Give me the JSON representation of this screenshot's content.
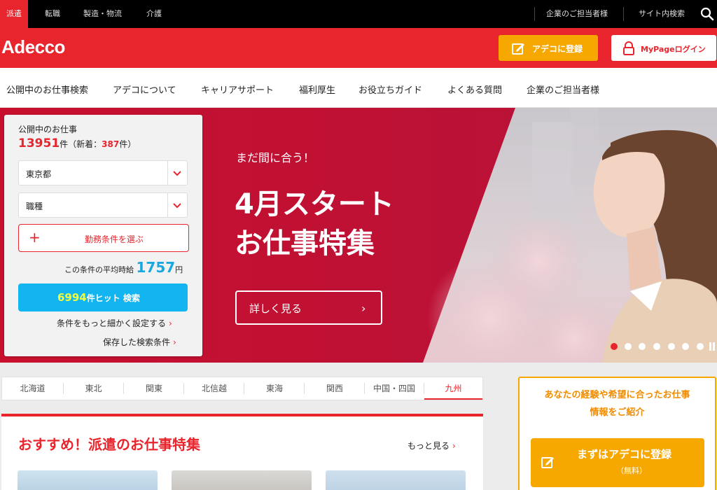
{
  "topbar": {
    "tabs": [
      "派遣",
      "転職",
      "製造・物流",
      "介護"
    ],
    "right_links": [
      "企業のご担当者様",
      "サイト内検索"
    ]
  },
  "header": {
    "logo": "Adecco",
    "register_label": "アデコに登録",
    "login_label": "MyPageログイン"
  },
  "nav": {
    "items": [
      "公開中のお仕事検索",
      "アデコについて",
      "キャリアサポート",
      "福利厚生",
      "お役立ちガイド",
      "よくある質問",
      "企業のご担当者様"
    ]
  },
  "hero": {
    "tagline": "まだ間に合う！",
    "headline_1": "4月スタート",
    "headline_2": "お仕事特集",
    "detail_label": "詳しく見る",
    "detail_arrow": "›",
    "slide_count": 7,
    "active_slide": 1
  },
  "search": {
    "caption": "公開中のお仕事",
    "total": "13951",
    "total_suffix": "件（新着：",
    "new_count": "387",
    "new_suffix": "件）",
    "pref_value": "東京都",
    "job_value": "職種",
    "condition_label": "勤務条件を選ぶ",
    "condition_plus": "+",
    "avg_label": "この条件の平均時給",
    "avg_value": "1757",
    "avg_unit": "円",
    "hit_count": "6994",
    "hit_label": "件ヒット 検索",
    "detail_link": "条件をもっと細かく設定する",
    "saved_link": "保存した検索条件",
    "link_arrow": "›"
  },
  "regions": [
    "北海道",
    "東北",
    "関東",
    "北信越",
    "東海",
    "関西",
    "中国・四国",
    "九州"
  ],
  "recommend": {
    "title": "おすすめ！派遣のお仕事特集",
    "more": "もっと見る",
    "more_arrow": "›"
  },
  "sidebox": {
    "message_1": "あなたの経験や希望に合ったお仕事",
    "message_2": "情報をご紹介",
    "button_label": "まずはアデコに登録",
    "button_sub": "（無料）"
  },
  "colors": {
    "brand_red": "#e8242c",
    "orange": "#f6a800",
    "blue": "#12b5ef"
  }
}
